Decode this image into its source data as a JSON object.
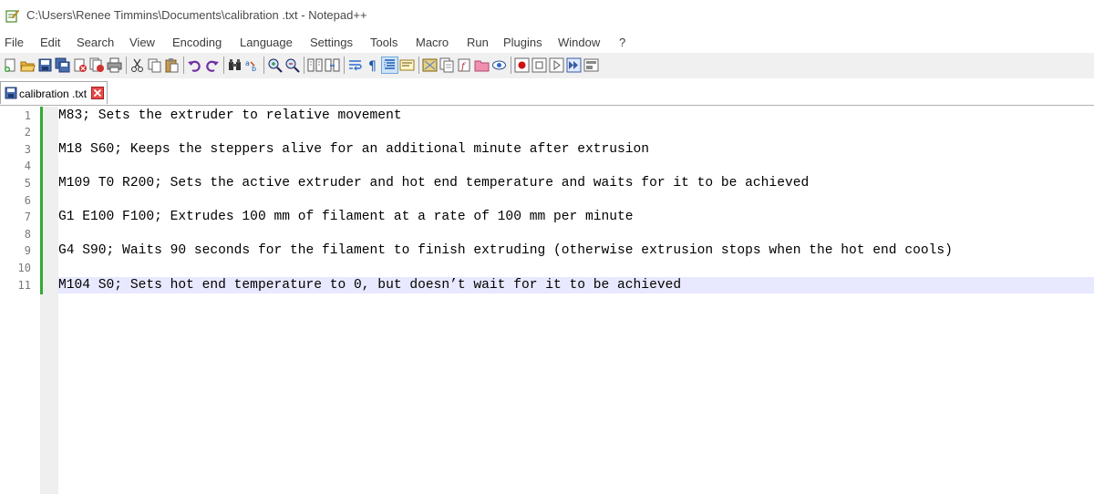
{
  "window": {
    "title": "C:\\Users\\Renee Timmins\\Documents\\calibration .txt - Notepad++",
    "app_icon": "notepad-plus-icon"
  },
  "menu": [
    "File",
    "Edit",
    "Search",
    "View",
    "Encoding",
    "Language",
    "Settings",
    "Tools",
    "Macro",
    "Run",
    "Plugins",
    "Window",
    "?"
  ],
  "toolbar": [
    "new-file-icon",
    "open-file-icon",
    "save-icon",
    "save-all-icon",
    "close-icon",
    "close-all-icon",
    "print-icon",
    "cut-icon",
    "copy-icon",
    "paste-icon",
    "undo-icon",
    "redo-icon",
    "find-icon",
    "replace-icon",
    "zoom-in-icon",
    "zoom-out-icon",
    "sync-vertical-icon",
    "sync-horizontal-icon",
    "word-wrap-icon",
    "show-all-chars-icon",
    "indent-guide-icon",
    "user-defined-language-icon",
    "document-map-icon",
    "function-list-icon",
    "folder-as-workspace-icon",
    "monitoring-icon",
    "record-macro-icon",
    "stop-recording-icon",
    "play-macro-icon",
    "run-macro-multiple-icon",
    "save-macro-icon"
  ],
  "tab": {
    "label": "calibration .txt",
    "icon": "saved-file-icon",
    "close_icon": "tab-close-icon"
  },
  "editor": {
    "line_numbers": [
      "1",
      "2",
      "3",
      "4",
      "5",
      "6",
      "7",
      "8",
      "9",
      "10",
      "11"
    ],
    "lines": [
      "M83; Sets the extruder to relative movement",
      "",
      "M18 S60; Keeps the steppers alive for an additional minute after extrusion",
      "",
      "M109 T0 R200; Sets the active extruder and hot end temperature and waits for it to be achieved",
      "",
      "G1 E100 F100; Extrudes 100 mm of filament at a rate of 100 mm per minute",
      "",
      "G4 S90; Waits 90 seconds for the filament to finish extruding (otherwise extrusion stops when the hot end cools)",
      "",
      "M104 S0; Sets hot end temperature to 0, but doesn’t wait for it to be achieved"
    ],
    "current_line": 11
  },
  "colors": {
    "current_line": "#e8e8ff",
    "change_history": "#33aa33",
    "toolbar_bg": "#f0f0f0"
  }
}
